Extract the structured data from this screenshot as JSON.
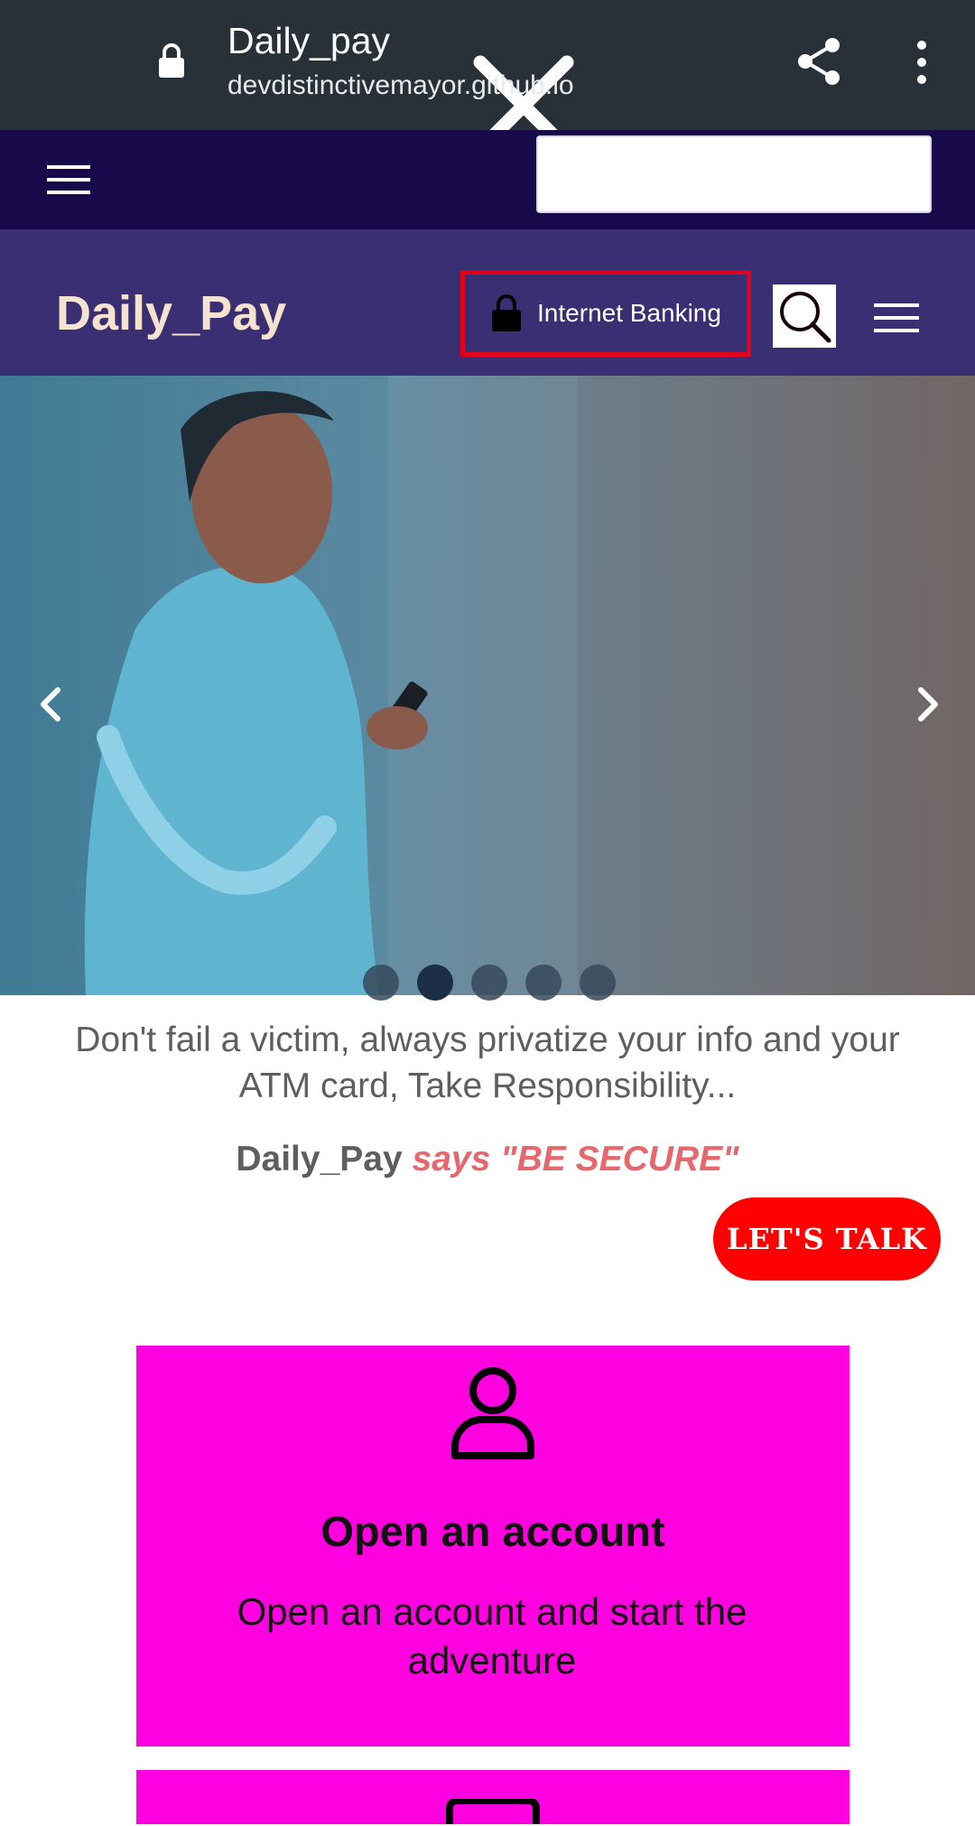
{
  "browser": {
    "title": "Daily_pay",
    "url": "devdistinctivemayor.github.io",
    "icons": [
      "close-icon",
      "lock-icon",
      "share-icon",
      "more-vert-icon"
    ]
  },
  "site": {
    "brand": "Daily_Pay",
    "internet_banking_label": "Internet Banking",
    "icons": [
      "hamburger-icon",
      "lock-icon",
      "search-icon",
      "menu-icon"
    ]
  },
  "carousel": {
    "slides": 5,
    "active_index": 2,
    "icons": [
      "chevron-left-icon",
      "chevron-right-icon"
    ]
  },
  "message": {
    "text": "Don't fail a victim, always privatize your info and your ATM card, Take Responsibility...",
    "brand": "Daily_Pay",
    "quote": "says \"BE SECURE\""
  },
  "cta": {
    "label": "LET'S TALK"
  },
  "card": {
    "title": "Open an account",
    "text": "Open an account and start the adventure",
    "icon": "user-icon"
  },
  "colors": {
    "chrome": "#283038",
    "topnav": "#17094a",
    "brandbar": "#3b2f73",
    "brand_text": "#f6e3cf",
    "highlight": "#e3001b",
    "cta": "#ff0000",
    "card": "#ff00e0",
    "quote": "#e5686e"
  }
}
